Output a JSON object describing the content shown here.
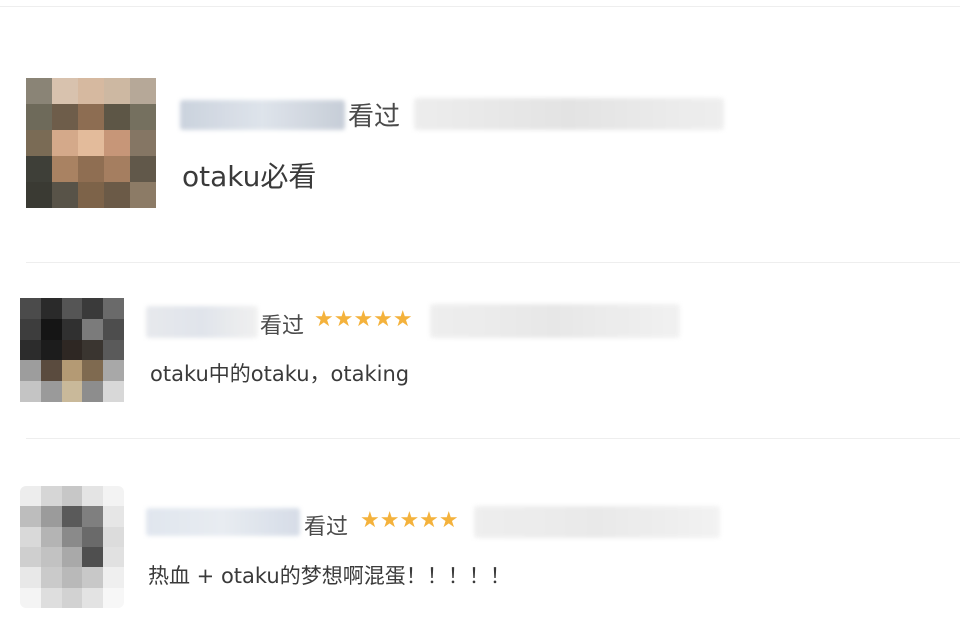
{
  "comments": [
    {
      "watched_label": "看过",
      "stars": "",
      "text": "otaku必看",
      "avatar_colors": [
        "#8a8476",
        "#d8c2ae",
        "#d6b9a0",
        "#cdb8a2",
        "#b6a898",
        "#6e6a5a",
        "#6e5d4a",
        "#8d6d52",
        "#5d5646",
        "#75705f",
        "#7a6b55",
        "#d4a98a",
        "#e3bb9b",
        "#c79678",
        "#857664",
        "#3e3f38",
        "#a98262",
        "#8f6e52",
        "#a57e60",
        "#61584a",
        "#3a3a33",
        "#585348",
        "#7d6349",
        "#6b5a47",
        "#8c7b66"
      ],
      "name_blur_colors": [
        "#c8d0dc",
        "#dde3ea",
        "#c4cbd6"
      ],
      "meta_blur_colors": [
        "#ececec",
        "#e2e2e2",
        "#eeeeee"
      ]
    },
    {
      "watched_label": "看过",
      "stars": "★★★★★",
      "text": "otaku中的otaku，otaking",
      "avatar_colors": [
        "#4b4b4b",
        "#2a2a2a",
        "#555555",
        "#3a3a3a",
        "#6a6a6a",
        "#3d3d3d",
        "#151515",
        "#303030",
        "#7b7b7b",
        "#4d4d4d",
        "#2c2c2c",
        "#1c1c1c",
        "#2e2723",
        "#3a3530",
        "#5a5a5a",
        "#9d9d9d",
        "#5a4b3e",
        "#b49a74",
        "#7f6a50",
        "#a8a8a8",
        "#c4c4c4",
        "#9a9a9a",
        "#c9b99a",
        "#8d8d8d",
        "#d8d8d8"
      ],
      "name_blur_colors": [
        "#e6e8ec",
        "#dfe3ea",
        "#f0f0f0"
      ],
      "meta_blur_colors": [
        "#eeeeee",
        "#e6e6e6",
        "#f1f1f1"
      ]
    },
    {
      "watched_label": "看过",
      "stars": "★★★★★",
      "text": "热血 + otaku的梦想啊混蛋！！！！！",
      "avatar_colors": [
        "#ededed",
        "#d6d6d6",
        "#c7c7c7",
        "#e4e4e4",
        "#f3f3f3",
        "#bdbdbd",
        "#9b9b9b",
        "#5a5a5a",
        "#7f7f7f",
        "#e6e6e6",
        "#d9d9d9",
        "#b4b4b4",
        "#8a8a8a",
        "#6a6a6a",
        "#dcdcdc",
        "#cfcfcf",
        "#c2c2c2",
        "#a9a9a9",
        "#4f4f4f",
        "#e1e1e1",
        "#e8e8e8",
        "#cacaca",
        "#b9b9b9",
        "#c8c8c8",
        "#efefef",
        "#f4f4f4",
        "#dedede",
        "#d2d2d2",
        "#e3e3e3",
        "#f7f7f7"
      ],
      "name_blur_colors": [
        "#dfe5ee",
        "#e7ebf1",
        "#d4dbe6"
      ],
      "meta_blur_colors": [
        "#eeeeee",
        "#e8e8e8",
        "#f2f2f2"
      ]
    }
  ],
  "colors": {
    "star": "#f4b23c",
    "divider": "#eeeeee",
    "text": "#3a3a3a"
  }
}
